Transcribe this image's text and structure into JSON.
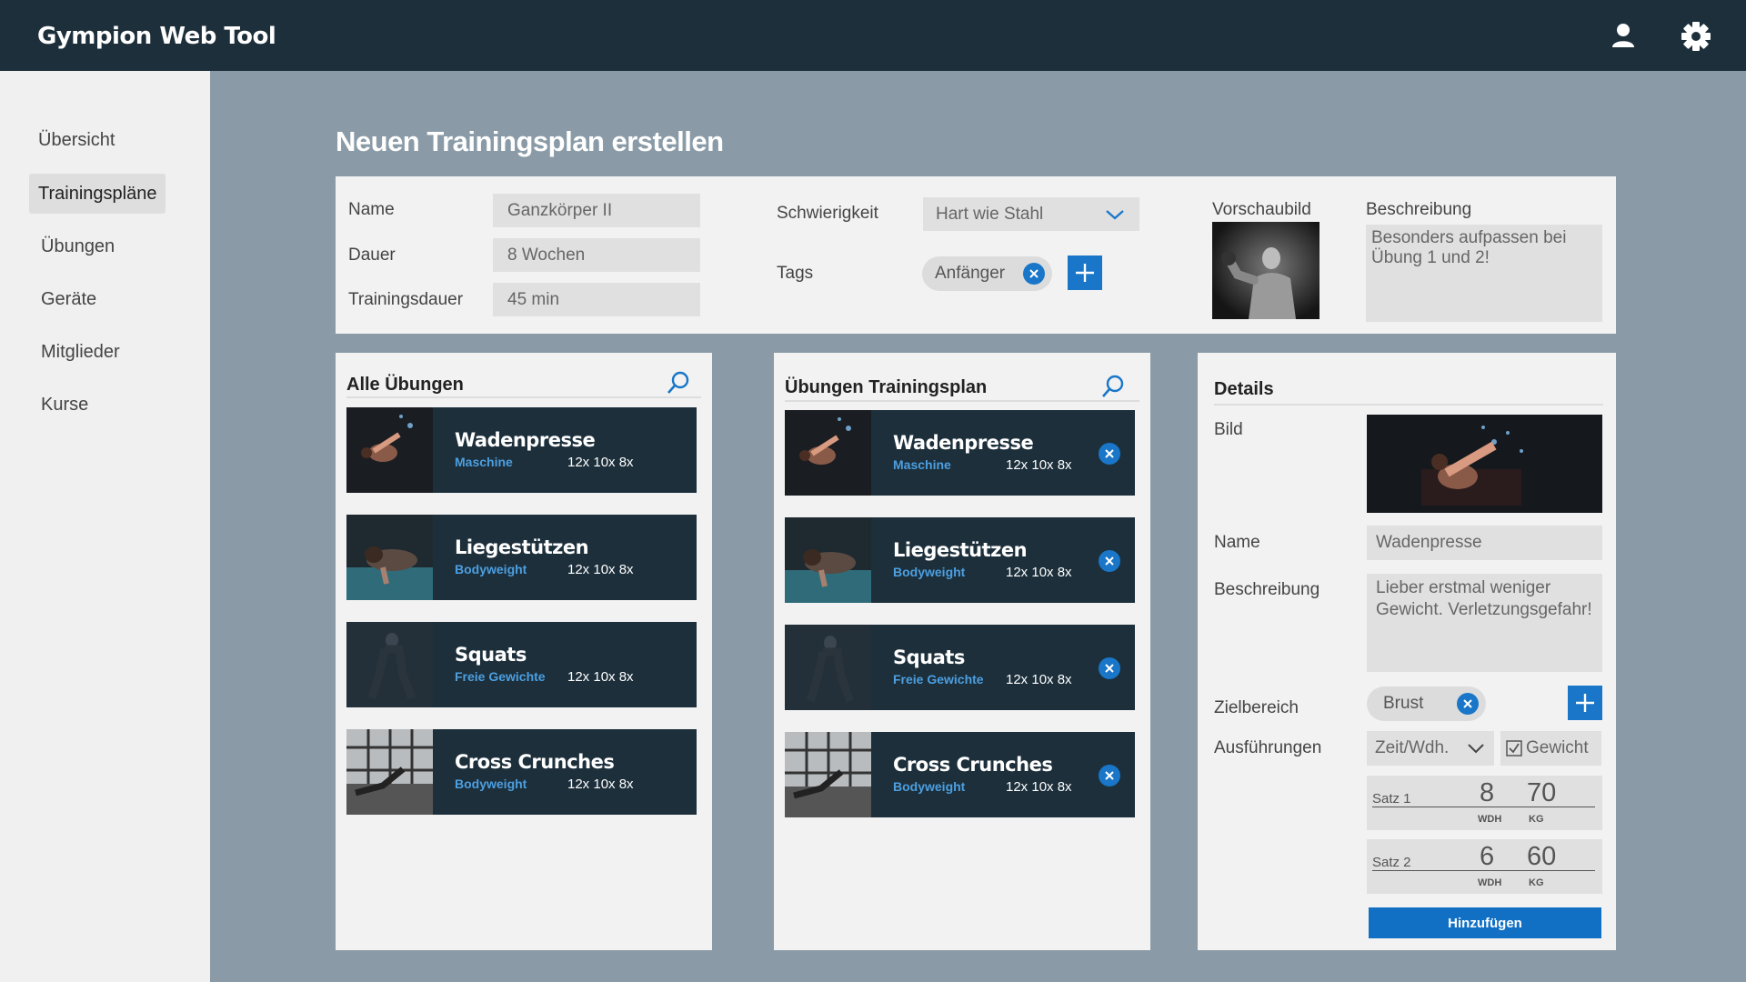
{
  "app": {
    "title": "Gympion Web Tool"
  },
  "header_icons": {
    "profile": "user-icon",
    "settings": "gear-icon"
  },
  "sidebar": {
    "items": [
      {
        "label": "Übersicht"
      },
      {
        "label": "Trainingspläne",
        "active": true
      },
      {
        "label": "Übungen"
      },
      {
        "label": "Geräte"
      },
      {
        "label": "Mitglieder"
      },
      {
        "label": "Kurse"
      }
    ]
  },
  "page": {
    "title": "Neuen Trainingsplan erstellen"
  },
  "plan": {
    "name_label": "Name",
    "name_value": "Ganzkörper II",
    "duration_label": "Dauer",
    "duration_value": "8 Wochen",
    "training_duration_label": "Trainingsdauer",
    "training_duration_value": "45 min",
    "difficulty_label": "Schwierigkeit",
    "difficulty_value": "Hart wie Stahl",
    "tags_label": "Tags",
    "tags": [
      {
        "label": "Anfänger"
      }
    ],
    "preview_label": "Vorschaubild",
    "description_label": "Beschreibung",
    "description_value": "Besonders aufpassen bei Übung 1 und 2!"
  },
  "all_exercises": {
    "title": "Alle Übungen",
    "items": [
      {
        "name": "Wadenpresse",
        "category": "Maschine",
        "reps": "12x 10x 8x"
      },
      {
        "name": "Liegestützen",
        "category": "Bodyweight",
        "reps": "12x 10x 8x"
      },
      {
        "name": "Squats",
        "category": "Freie Gewichte",
        "reps": "12x 10x 8x"
      },
      {
        "name": "Cross Crunches",
        "category": "Bodyweight",
        "reps": "12x 10x 8x"
      }
    ]
  },
  "plan_exercises": {
    "title": "Übungen Trainingsplan",
    "items": [
      {
        "name": "Wadenpresse",
        "category": "Maschine",
        "reps": "12x 10x 8x"
      },
      {
        "name": "Liegestützen",
        "category": "Bodyweight",
        "reps": "12x 10x 8x"
      },
      {
        "name": "Squats",
        "category": "Freie Gewichte",
        "reps": "12x 10x 8x"
      },
      {
        "name": "Cross Crunches",
        "category": "Bodyweight",
        "reps": "12x 10x 8x"
      }
    ]
  },
  "details": {
    "title": "Details",
    "image_label": "Bild",
    "name_label": "Name",
    "name_value": "Wadenpresse",
    "description_label": "Beschreibung",
    "description_value": "Lieber erstmal weniger Gewicht. Verletzungsgefahr!",
    "target_label": "Zielbereich",
    "target_chip": "Brust",
    "executions_label": "Ausführungen",
    "executions_mode": "Zeit/Wdh.",
    "weight_checkbox_label": "Gewicht",
    "weight_checked": true,
    "sets": [
      {
        "label": "Satz 1",
        "reps": "8",
        "weight": "70",
        "reps_unit": "WDH",
        "weight_unit": "KG"
      },
      {
        "label": "Satz 2",
        "reps": "6",
        "weight": "60",
        "reps_unit": "WDH",
        "weight_unit": "KG"
      }
    ],
    "add_button": "Hinzufügen"
  },
  "colors": {
    "topbar": "#1c2f3b",
    "background": "#8a9ba7",
    "accent": "#1976c8",
    "card": "#1c2f3b",
    "category_text": "#4d9fe0"
  }
}
